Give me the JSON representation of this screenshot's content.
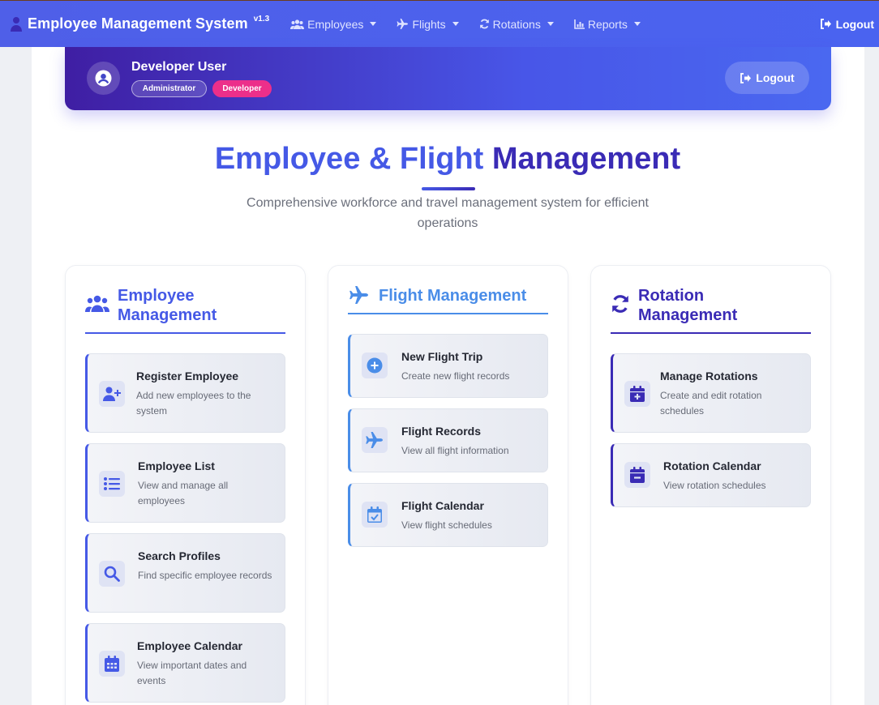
{
  "navbar": {
    "brand": "Employee Management System",
    "version": "v1.3",
    "items": [
      {
        "label": "Employees",
        "icon": "users-icon"
      },
      {
        "label": "Flights",
        "icon": "plane-icon"
      },
      {
        "label": "Rotations",
        "icon": "sync-icon"
      },
      {
        "label": "Reports",
        "icon": "chart-icon"
      }
    ],
    "logout": "Logout"
  },
  "user": {
    "name": "Developer User",
    "badges": [
      "Administrator",
      "Developer"
    ],
    "logout": "Logout"
  },
  "hero": {
    "title_part1": "Employee",
    "title_amp": "&",
    "title_part2": "Flight",
    "title_part3": "Management",
    "subtitle": "Comprehensive workforce and travel management system for efficient operations"
  },
  "sections": [
    {
      "title": "Employee Management",
      "icon": "users-icon",
      "items": [
        {
          "title": "Register Employee",
          "desc": "Add new employees to the system",
          "icon": "user-plus-icon"
        },
        {
          "title": "Employee List",
          "desc": "View and manage all employees",
          "icon": "list-icon"
        },
        {
          "title": "Search Profiles",
          "desc": "Find specific employee records",
          "icon": "search-icon"
        },
        {
          "title": "Employee Calendar",
          "desc": "View important dates and events",
          "icon": "calendar-icon"
        }
      ]
    },
    {
      "title": "Flight Management",
      "icon": "plane-icon",
      "items": [
        {
          "title": "New Flight Trip",
          "desc": "Create new flight records",
          "icon": "plus-circle-icon"
        },
        {
          "title": "Flight Records",
          "desc": "View all flight information",
          "icon": "plane-icon"
        },
        {
          "title": "Flight Calendar",
          "desc": "View flight schedules",
          "icon": "calendar-check-icon"
        }
      ]
    },
    {
      "title": "Rotation Management",
      "icon": "sync-icon",
      "items": [
        {
          "title": "Manage Rotations",
          "desc": "Create and edit rotation schedules",
          "icon": "calendar-plus-icon"
        },
        {
          "title": "Rotation Calendar",
          "desc": "View rotation schedules",
          "icon": "calendar-minus-icon"
        }
      ]
    }
  ],
  "colors": {
    "primary": "#4559e6",
    "flight": "#4a8de8",
    "rotation": "#3a2bb5",
    "developer_badge": "#ec2f8a"
  }
}
